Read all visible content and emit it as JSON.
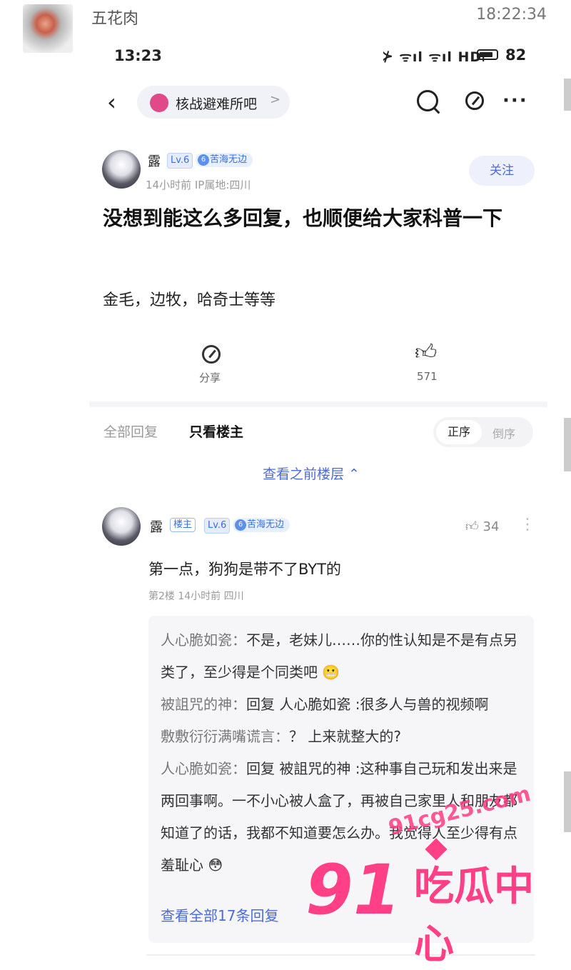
{
  "chat": {
    "sender": "五花肉",
    "time": "18:22:34"
  },
  "status_bar": {
    "time": "13:23",
    "signal_text": "⊁ ᯤıl ᯤıl HDᵢ",
    "battery_level": 0.82,
    "battery_text": "82"
  },
  "nav": {
    "back_icon": "chevron-left-icon",
    "forum_name": "核战避难所吧",
    "forum_arrow": ">",
    "more": "···"
  },
  "post": {
    "author": "露",
    "level": "Lv.6",
    "title_badge": "苦海无边",
    "meta": "14小时前   IP属地:四川",
    "follow_label": "关注",
    "title": "没想到能这么多回复，也顺便给大家科普一下",
    "body": "金毛，边牧，哈奇士等等",
    "share_label": "分享",
    "likes": "571"
  },
  "tabs": {
    "all": "全部回复",
    "op_only": "只看楼主",
    "sort_asc": "正序",
    "sort_desc": "倒序"
  },
  "prev_floors": "查看之前楼层 ⌃",
  "comment": {
    "author": "露",
    "op_badge": "楼主",
    "level": "Lv.6",
    "title_badge": "苦海无边",
    "likes": "34",
    "more": "⋮",
    "text": "第一点，狗狗是带不了BYT的",
    "meta": "第2楼  14小时前  四川",
    "replies": [
      {
        "user": "人心脆如瓷：",
        "text": "不是，老妹儿……你的性认知是不是有点另类了，至少得是个同类吧 😬"
      },
      {
        "user": "被詛咒的神：",
        "text": "回复 人心脆如瓷 :很多人与兽的视频啊"
      },
      {
        "user": "敷敷衍衍满嘴谎言：",
        "text": "？  上来就整大的?"
      },
      {
        "user": "人心脆如瓷：",
        "text": "回复 被詛咒的神 :这种事自己玩和发出来是两回事啊。一不小心被人盒了，再被自己家里人和朋友都知道了的话，我都不知道要怎么办。我觉得人至少得有点羞耻心 😳"
      }
    ],
    "view_all": "查看全部17条回复"
  },
  "watermark": {
    "url": "91cg25.com",
    "number": "91",
    "label": "吃瓜中心"
  }
}
